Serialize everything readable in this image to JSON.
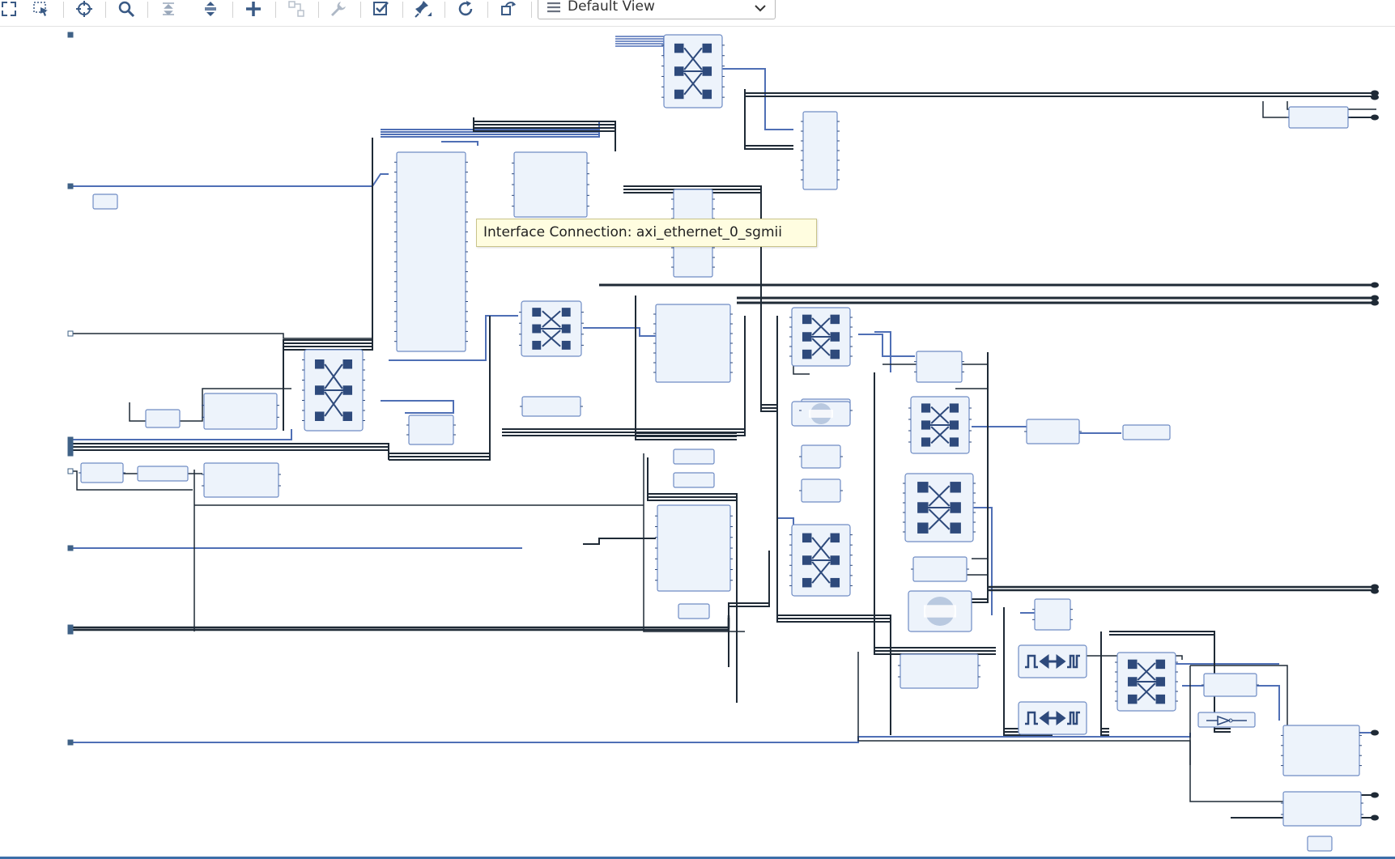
{
  "toolbar": {
    "buttons": [
      {
        "name": "fit-view-icon"
      },
      {
        "name": "select-area-icon"
      },
      {
        "name": "crosshair-icon"
      },
      {
        "name": "zoom-icon"
      },
      {
        "name": "collapse-all-icon"
      },
      {
        "name": "expand-all-icon"
      },
      {
        "name": "add-ip-icon"
      },
      {
        "name": "make-connection-icon"
      },
      {
        "name": "wrench-icon"
      },
      {
        "name": "validate-design-icon"
      },
      {
        "name": "pin-icon"
      },
      {
        "name": "refresh-icon"
      },
      {
        "name": "regenerate-layout-icon"
      }
    ],
    "view_select": {
      "value": "Default View",
      "options": [
        "Default View"
      ]
    }
  },
  "tooltip": {
    "text": "Interface Connection: axi_ethernet_0_sgmii"
  },
  "colors": {
    "net_black": "#1f2a36",
    "net_blue": "#4f6fb5",
    "block_fill": "#edf3fb",
    "block_border": "#6f8cc4",
    "block_icon": "#2e4a7c",
    "tooltip_bg": "#fffde0",
    "status_bar": "#3c6ea8"
  },
  "diagram": {
    "blocks": [
      {
        "id": "interconnect-top",
        "kind": "interconnect"
      },
      {
        "id": "interconnect-mid-1",
        "kind": "interconnect"
      },
      {
        "id": "interconnect-mid-2",
        "kind": "interconnect"
      },
      {
        "id": "interconnect-left",
        "kind": "interconnect"
      },
      {
        "id": "interconnect-right-1",
        "kind": "interconnect"
      },
      {
        "id": "interconnect-right-2",
        "kind": "interconnect"
      },
      {
        "id": "interconnect-center",
        "kind": "interconnect"
      },
      {
        "id": "interconnect-bottom",
        "kind": "interconnect"
      },
      {
        "id": "rtl-module-small",
        "kind": "rtl"
      },
      {
        "id": "rtl-module-large",
        "kind": "rtl"
      },
      {
        "id": "clock-converter-1",
        "kind": "clock-converter"
      },
      {
        "id": "clock-converter-2",
        "kind": "clock-converter"
      },
      {
        "id": "inverter",
        "kind": "inverter"
      }
    ]
  }
}
